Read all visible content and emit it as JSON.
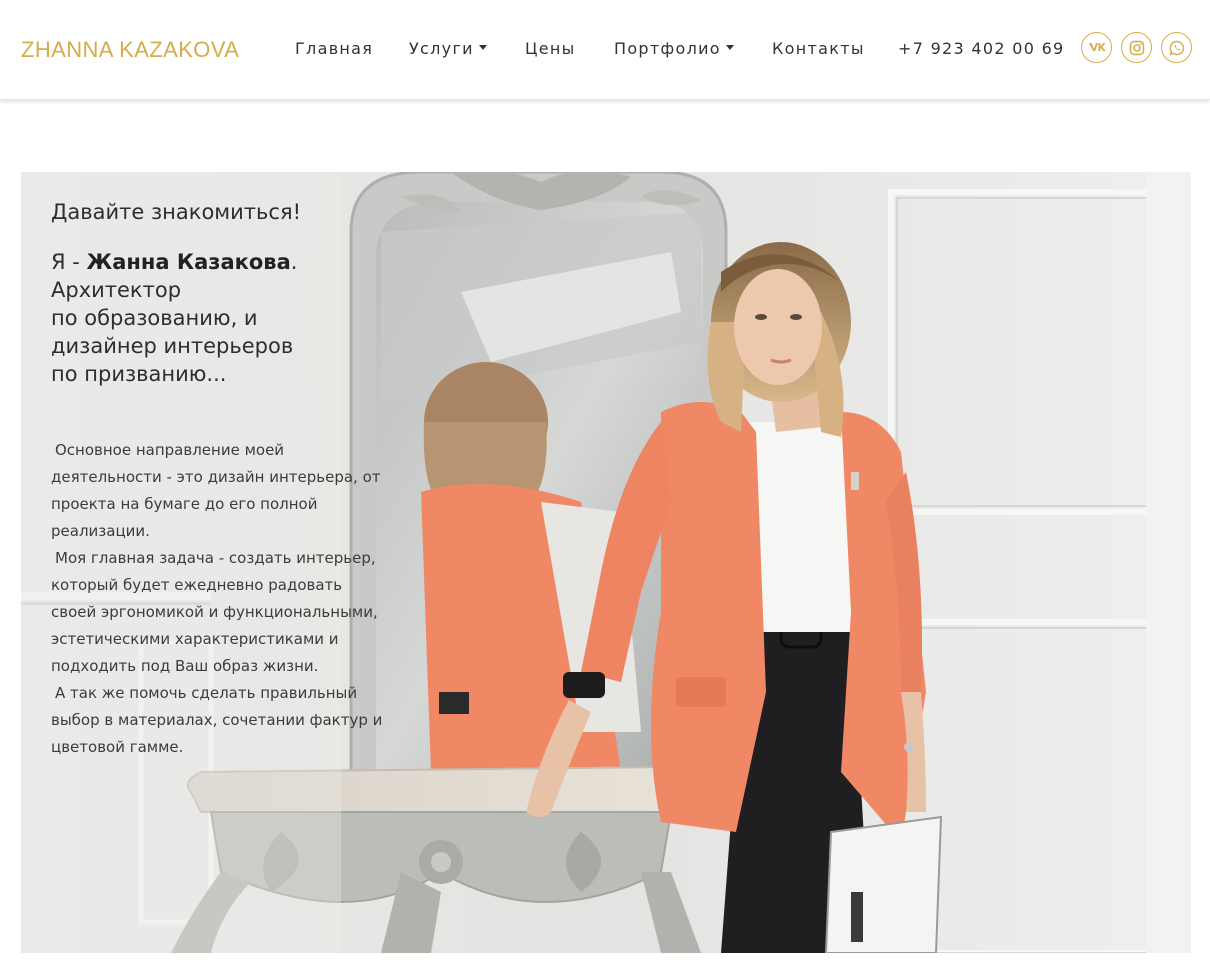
{
  "header": {
    "logo": "ZHANNA KAZAKOVA",
    "nav": [
      {
        "label": "Главная"
      },
      {
        "label": "Услуги",
        "dropdown": true
      },
      {
        "label": "Цены"
      },
      {
        "label": "Портфолио",
        "dropdown": true
      },
      {
        "label": "Контакты"
      }
    ],
    "phone": "+7 923 402 00 69",
    "social": [
      {
        "icon": "vk-icon"
      },
      {
        "icon": "instagram-icon"
      },
      {
        "icon": "whatsapp-icon"
      }
    ]
  },
  "hero": {
    "title": "Давайте знакомиться!",
    "intro_prefix": "Я - ",
    "intro_name": "Жанна Казакова",
    "intro_suffix": ".",
    "intro_lines": [
      "Архитектор",
      "по образованию, и",
      "дизайнер интерьеров",
      "по призванию..."
    ],
    "paragraphs": [
      "Основное направление моей деятельности - это дизайн интерьера, от проекта на бумаге до его полной реализации.",
      "Моя главная задача - создать интерьер, который будет ежедневно радовать своей эргономикой и функциональными, эстетическими характеристиками и подходить под Ваш образ жизни.",
      "А так же помочь сделать правильный выбор в материалах, сочетании фактур и цветовой гамме."
    ]
  },
  "colors": {
    "accent_gold": "#d4ac4c",
    "blazer": "#f08866",
    "text_dark": "#2e2e2e"
  }
}
